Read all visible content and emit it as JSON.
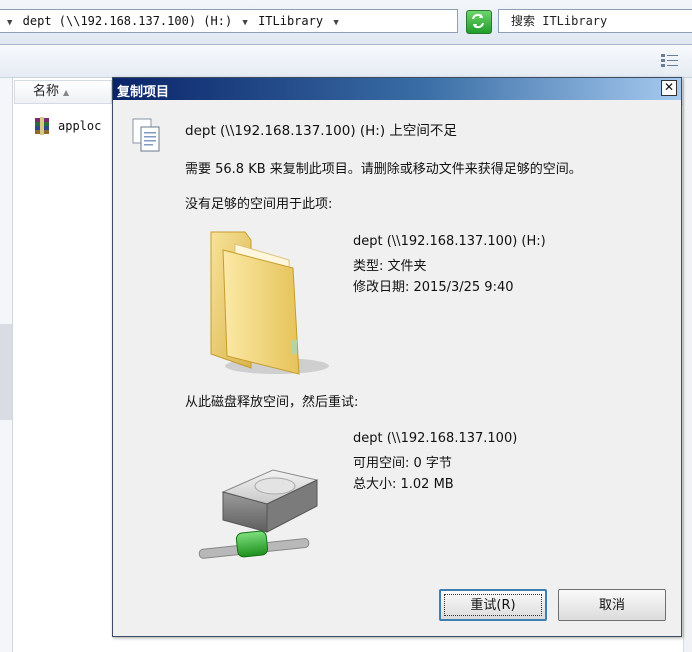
{
  "explorer": {
    "address_segments": [
      "dept (\\\\192.168.137.100) (H:)",
      "ITLibrary"
    ],
    "search_placeholder": "搜索 ITLibrary",
    "column_name": "名称",
    "file_name": "apploc"
  },
  "dialog": {
    "title": "复制项目",
    "heading": "dept (\\\\192.168.137.100) (H:) 上空间不足",
    "message": "需要 56.8 KB 来复制此项目。请删除或移动文件来获得足够的空间。",
    "insufficient_label": "没有足够的空间用于此项:",
    "folder": {
      "name": "dept (\\\\192.168.137.100) (H:)",
      "type": "类型: 文件夹",
      "modified": "修改日期: 2015/3/25 9:40"
    },
    "free_space_label": "从此磁盘释放空间，然后重试:",
    "drive": {
      "name": "dept (\\\\192.168.137.100)",
      "free": "可用空间: 0 字节",
      "total": "总大小: 1.02 MB"
    },
    "buttons": {
      "retry": "重试(R)",
      "cancel": "取消"
    },
    "close_glyph": "✕"
  }
}
